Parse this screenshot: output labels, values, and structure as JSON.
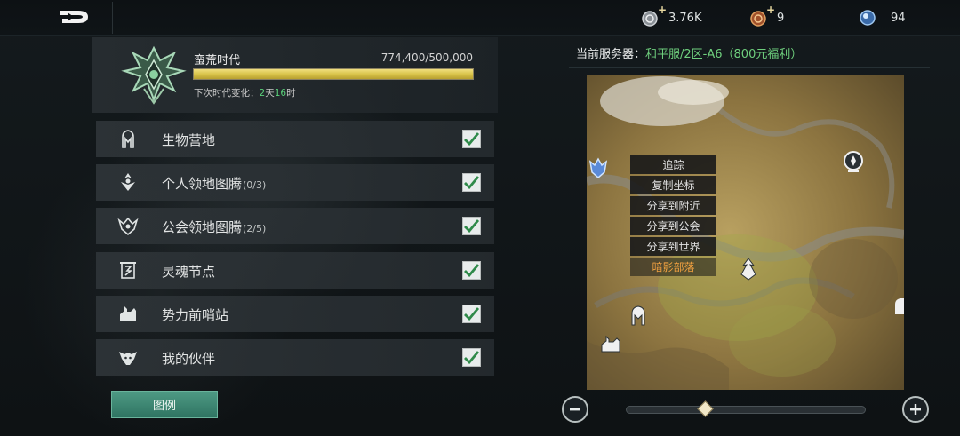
{
  "top_bar": {
    "back_icon": "back-arrow-icon",
    "currencies": [
      {
        "icon": "silver-coin-icon",
        "value": "3.76K",
        "has_plus": true
      },
      {
        "icon": "bronze-coin-icon",
        "value": "9",
        "has_plus": true
      },
      {
        "icon": "blue-orb-icon",
        "value": "94",
        "has_plus": false
      }
    ]
  },
  "era": {
    "title": "蛮荒时代",
    "progress_text": "774,400/500,000",
    "progress_fraction": 1.0,
    "next_label": "下次时代变化：",
    "next_value_a": "2",
    "next_unit_a": "天",
    "next_value_b": "16",
    "next_unit_b": "时"
  },
  "filters": [
    {
      "label": "生物营地",
      "count": "",
      "icon": "creature-camp-icon",
      "checked": true
    },
    {
      "label": "个人领地图腾",
      "count": "(0/3)",
      "icon": "personal-totem-icon",
      "checked": true
    },
    {
      "label": "公会领地图腾",
      "count": "(2/5)",
      "icon": "guild-totem-icon",
      "checked": true
    },
    {
      "label": "灵魂节点",
      "count": "",
      "icon": "soul-node-icon",
      "checked": true
    },
    {
      "label": "势力前哨站",
      "count": "",
      "icon": "outpost-icon",
      "checked": true
    },
    {
      "label": "我的伙伴",
      "count": "",
      "icon": "companion-icon",
      "checked": true
    }
  ],
  "legend_button": "图例",
  "server": {
    "label": "当前服务器：",
    "value": "和平服/2区-A6（800元福利）"
  },
  "context_menu": {
    "items": [
      "追踪",
      "复制坐标",
      "分享到附近",
      "分享到公会",
      "分享到世界"
    ],
    "location_name": "暗影部落"
  },
  "zoom": {
    "level_fraction": 0.33,
    "minus_icon": "minus-icon",
    "plus_icon": "plus-icon"
  },
  "colors": {
    "accent_green": "#6fd07e",
    "progress_gold": "#d9c44a",
    "legend_teal": "#3f8a74",
    "highlight_orange": "#f0a040"
  }
}
